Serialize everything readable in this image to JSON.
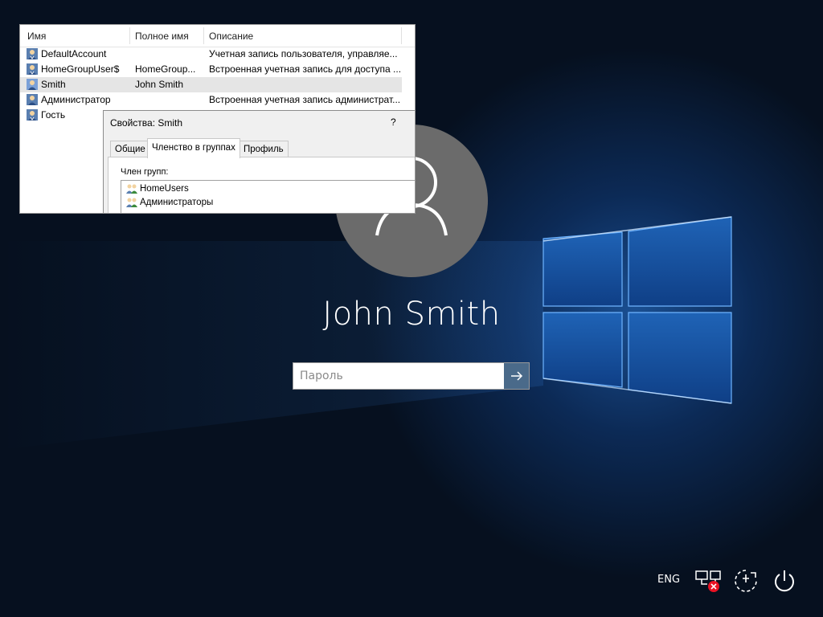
{
  "login": {
    "user_display_name": "John Smith",
    "password_placeholder": "Пароль",
    "submit_icon": "arrow-right-icon",
    "avatar_icon": "user-silhouette-icon"
  },
  "tray": {
    "language": "ENG",
    "network_icon": "network-disconnected-icon",
    "accessibility_icon": "ease-of-access-icon",
    "power_icon": "power-icon"
  },
  "user_list": {
    "columns": [
      "Имя",
      "Полное имя",
      "Описание"
    ],
    "rows": [
      {
        "name": "DefaultAccount",
        "full_name": "",
        "description": "Учетная запись пользователя, управляе..."
      },
      {
        "name": "HomeGroupUser$",
        "full_name": "HomeGroup...",
        "description": "Встроенная учетная запись для доступа ..."
      },
      {
        "name": "Smith",
        "full_name": "John Smith",
        "description": ""
      },
      {
        "name": "Администратор",
        "full_name": "",
        "description": "Встроенная учетная запись администрат..."
      },
      {
        "name": "Гость",
        "full_name": "",
        "description": ""
      }
    ]
  },
  "properties_dialog": {
    "title": "Свойства: Smith",
    "help": "?",
    "tabs": [
      "Общие",
      "Членство в группах",
      "Профиль"
    ],
    "member_of_label": "Член групп:",
    "groups": [
      "HomeUsers",
      "Администраторы"
    ]
  },
  "colors": {
    "accent": "#4a6a8a",
    "avatar_bg": "#6b6b6b",
    "selected_row": "#e5e5e5",
    "wallpaper": "#06101f"
  }
}
